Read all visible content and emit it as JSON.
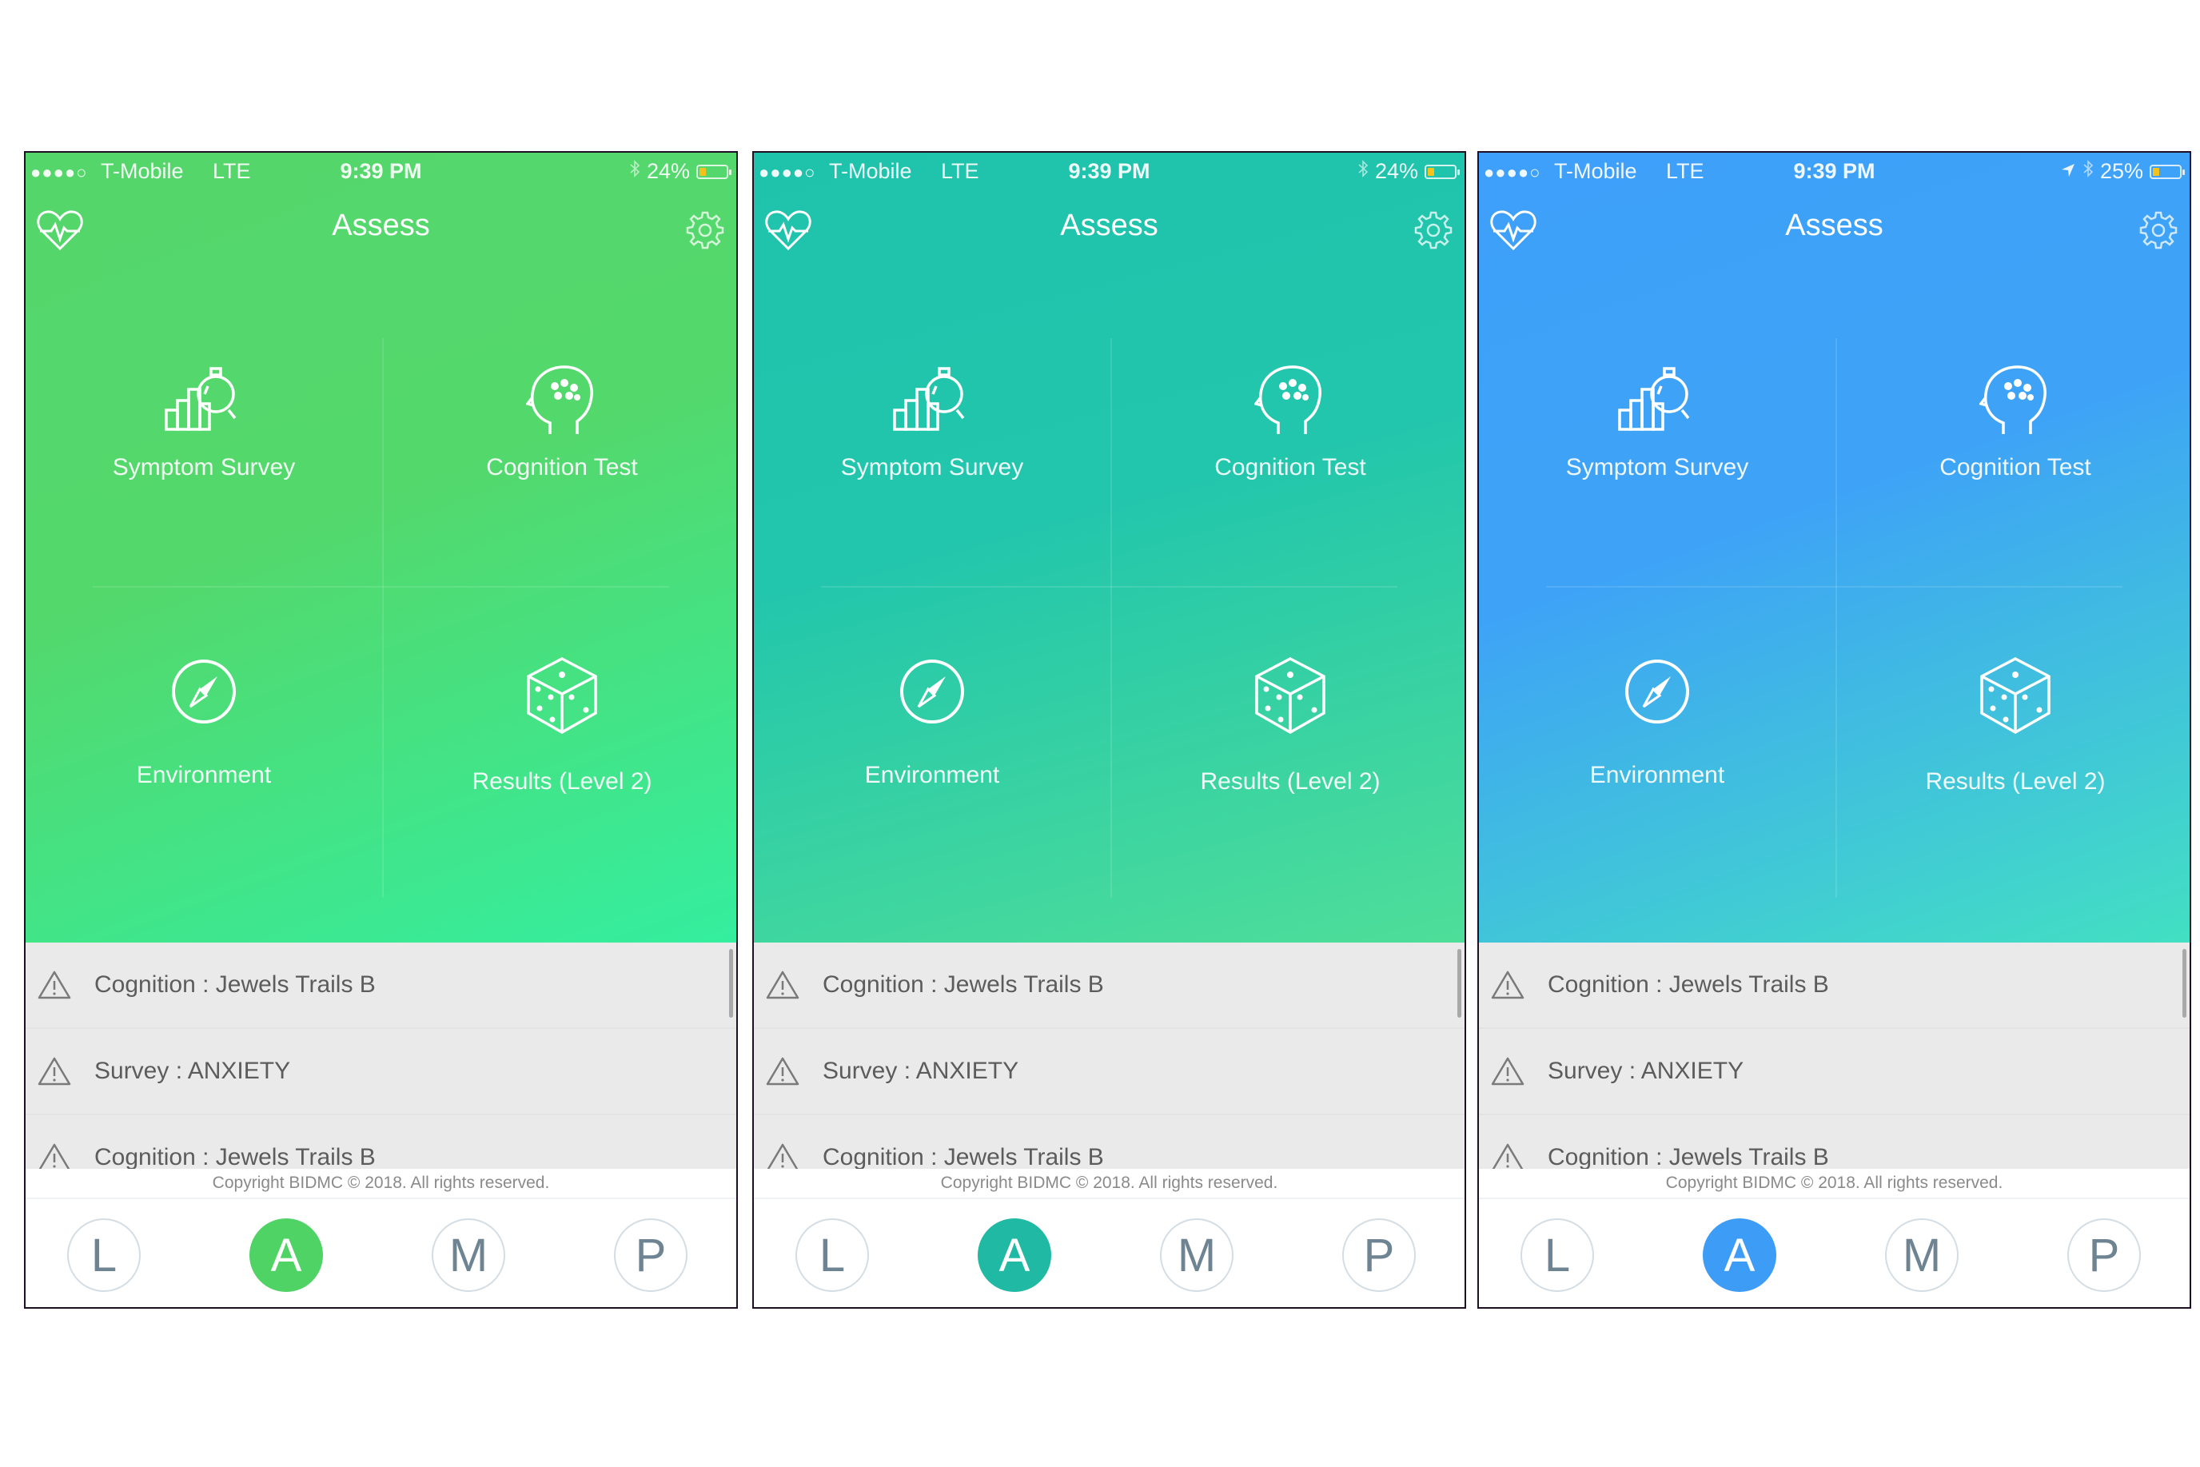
{
  "screens": [
    {
      "theme": "green",
      "accent_color": "#4fd365",
      "status_bar": {
        "signal": "●●●●○",
        "carrier": "T-Mobile",
        "network": "LTE",
        "time": "9:39 PM",
        "location_icon": false,
        "bluetooth_icon": true,
        "battery_label": "24%",
        "battery_percent": 24
      },
      "header": {
        "title": "Assess",
        "left_icon": "heart-pulse-icon",
        "right_icon": "gear-icon"
      },
      "tiles": [
        {
          "label": "Symptom Survey",
          "icon": "chart-stopwatch-icon"
        },
        {
          "label": "Cognition Test",
          "icon": "brain-head-icon"
        },
        {
          "label": "Environment",
          "icon": "compass-icon"
        },
        {
          "label": "Results (Level 2)",
          "icon": "dice-icon"
        }
      ],
      "alerts": [
        {
          "icon": "warning-icon",
          "text": "Cognition : Jewels Trails B"
        },
        {
          "icon": "warning-icon",
          "text": "Survey : ANXIETY"
        },
        {
          "icon": "warning-icon",
          "text": "Cognition : Jewels Trails B"
        }
      ],
      "copyright": "Copyright BIDMC © 2018. All rights reserved.",
      "tabs": [
        {
          "label": "L",
          "active": false
        },
        {
          "label": "A",
          "active": true
        },
        {
          "label": "M",
          "active": false
        },
        {
          "label": "P",
          "active": false
        }
      ]
    },
    {
      "theme": "teal",
      "accent_color": "#1fb9a4",
      "status_bar": {
        "signal": "●●●●○",
        "carrier": "T-Mobile",
        "network": "LTE",
        "time": "9:39 PM",
        "location_icon": false,
        "bluetooth_icon": true,
        "battery_label": "24%",
        "battery_percent": 24
      },
      "header": {
        "title": "Assess",
        "left_icon": "heart-pulse-icon",
        "right_icon": "gear-icon"
      },
      "tiles": [
        {
          "label": "Symptom Survey",
          "icon": "chart-stopwatch-icon"
        },
        {
          "label": "Cognition Test",
          "icon": "brain-head-icon"
        },
        {
          "label": "Environment",
          "icon": "compass-icon"
        },
        {
          "label": "Results (Level 2)",
          "icon": "dice-icon"
        }
      ],
      "alerts": [
        {
          "icon": "warning-icon",
          "text": "Cognition : Jewels Trails B"
        },
        {
          "icon": "warning-icon",
          "text": "Survey : ANXIETY"
        },
        {
          "icon": "warning-icon",
          "text": "Cognition : Jewels Trails B"
        }
      ],
      "copyright": "Copyright BIDMC © 2018. All rights reserved.",
      "tabs": [
        {
          "label": "L",
          "active": false
        },
        {
          "label": "A",
          "active": true
        },
        {
          "label": "M",
          "active": false
        },
        {
          "label": "P",
          "active": false
        }
      ]
    },
    {
      "theme": "blue",
      "accent_color": "#3d9cf5",
      "status_bar": {
        "signal": "●●●●○",
        "carrier": "T-Mobile",
        "network": "LTE",
        "time": "9:39 PM",
        "location_icon": true,
        "bluetooth_icon": true,
        "battery_label": "25%",
        "battery_percent": 25
      },
      "header": {
        "title": "Assess",
        "left_icon": "heart-pulse-icon",
        "right_icon": "gear-icon"
      },
      "tiles": [
        {
          "label": "Symptom Survey",
          "icon": "chart-stopwatch-icon"
        },
        {
          "label": "Cognition Test",
          "icon": "brain-head-icon"
        },
        {
          "label": "Environment",
          "icon": "compass-icon"
        },
        {
          "label": "Results (Level 2)",
          "icon": "dice-icon"
        }
      ],
      "alerts": [
        {
          "icon": "warning-icon",
          "text": "Cognition : Jewels Trails B"
        },
        {
          "icon": "warning-icon",
          "text": "Survey : ANXIETY"
        },
        {
          "icon": "warning-icon",
          "text": "Cognition : Jewels Trails B"
        }
      ],
      "copyright": "Copyright BIDMC © 2018. All rights reserved.",
      "tabs": [
        {
          "label": "L",
          "active": false
        },
        {
          "label": "A",
          "active": true
        },
        {
          "label": "M",
          "active": false
        },
        {
          "label": "P",
          "active": false
        }
      ]
    }
  ]
}
